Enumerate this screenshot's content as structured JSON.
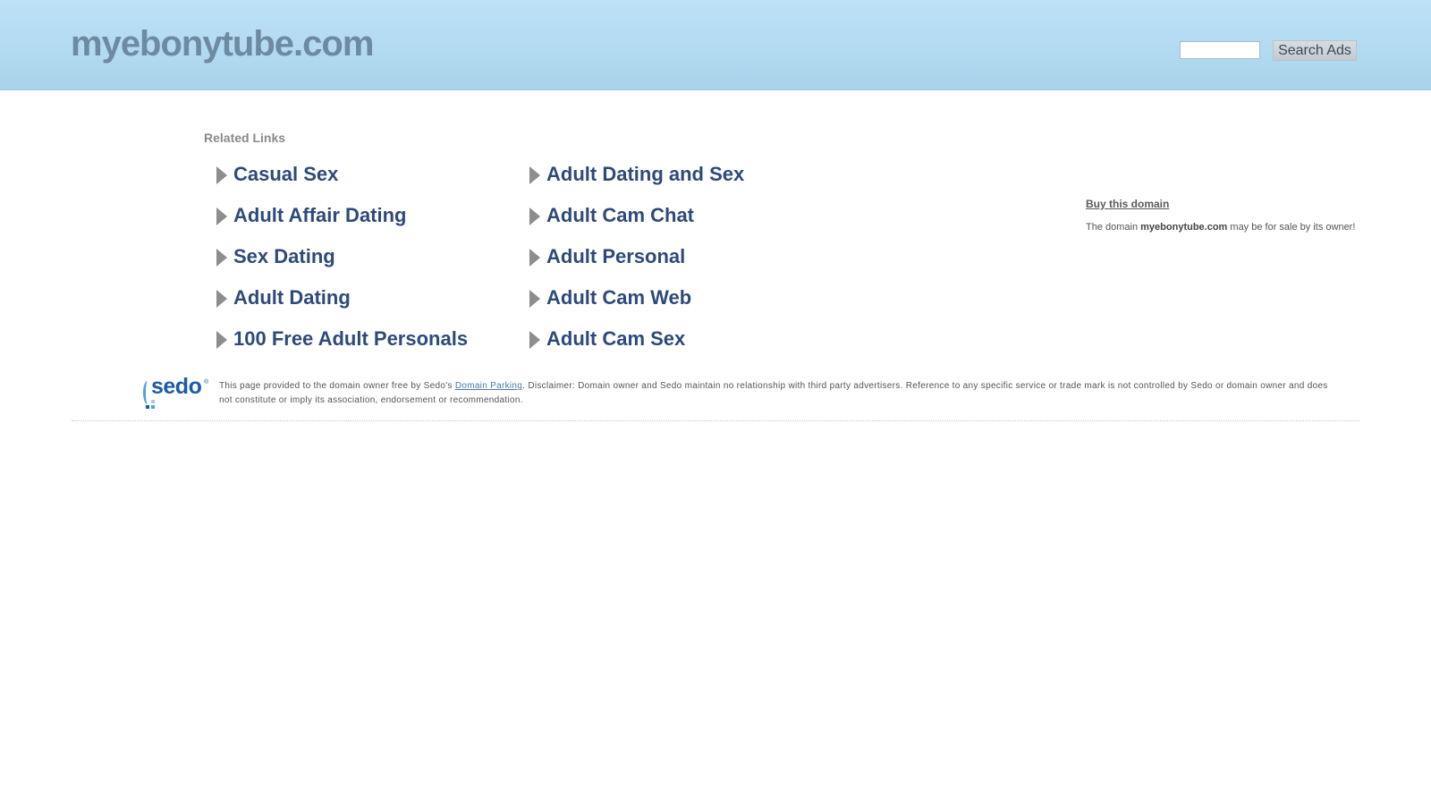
{
  "header": {
    "site_title": "myebonytube.com",
    "search_placeholder": "",
    "search_button_label": "Search Ads"
  },
  "related": {
    "heading": "Related Links",
    "left_column": [
      {
        "label": "Casual Sex"
      },
      {
        "label": "Adult Affair Dating"
      },
      {
        "label": "Sex Dating"
      },
      {
        "label": "Adult Dating"
      },
      {
        "label": "100 Free Adult Personals"
      }
    ],
    "right_column": [
      {
        "label": "Adult Dating and Sex"
      },
      {
        "label": "Adult Cam Chat"
      },
      {
        "label": "Adult Personal"
      },
      {
        "label": "Adult Cam Web"
      },
      {
        "label": "Adult Cam Sex"
      }
    ]
  },
  "sidebar": {
    "buy_link": "Buy this domain",
    "sale_prefix": "The domain ",
    "sale_domain": "myebonytube.com",
    "sale_suffix": " may be for sale by its owner!"
  },
  "footer": {
    "logo_text": "sedo",
    "logo_reg": "®",
    "text_prefix": "This page provided to the domain owner free by Sedo's ",
    "link_label": "Domain Parking",
    "text_suffix": ". Disclaimer: Domain owner and Sedo maintain no relationship with third party advertisers. Reference to any specific service or trade mark is not controlled by Sedo or domain owner and does not constitute or imply its association, endorsement or recommendation."
  },
  "colors": {
    "header_bg": "#b4dcf2",
    "title": "#6e8aa1",
    "link": "#2e4a7a",
    "arrow": "#8d8d8d",
    "sedo_blue": "#1d5aa8"
  },
  "icons": {
    "link_bullet": "triangle-arrow-right-icon",
    "logo": "sedo-logo"
  }
}
